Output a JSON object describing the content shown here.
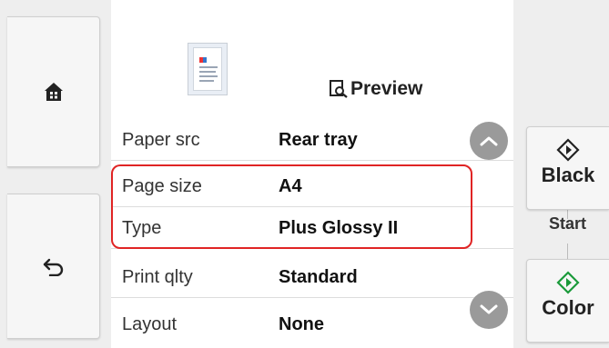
{
  "nav": {
    "home_icon": "home-icon",
    "back_icon": "back-arrow-icon"
  },
  "preview": {
    "label": "Preview",
    "icon": "preview-magnifier-icon"
  },
  "settings": [
    {
      "label": "Paper src",
      "value": "Rear tray"
    },
    {
      "label": "Page size",
      "value": "A4"
    },
    {
      "label": "Type",
      "value": "Plus Glossy II"
    },
    {
      "label": "Print qlty",
      "value": "Standard"
    },
    {
      "label": "Layout",
      "value": "None"
    }
  ],
  "start": {
    "label": "Start",
    "black": "Black",
    "color": "Color"
  },
  "colors": {
    "highlight": "#e02424",
    "color_start": "#1a9a3a",
    "black_start": "#222222"
  }
}
